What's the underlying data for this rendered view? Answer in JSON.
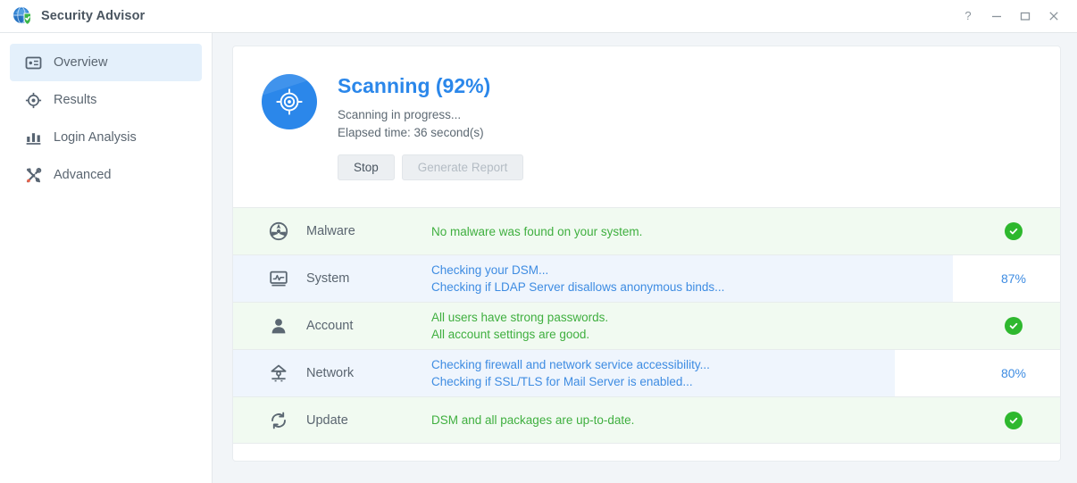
{
  "window": {
    "title": "Security Advisor",
    "app_icon": "shield-globe-icon",
    "controls": [
      {
        "name": "help-button",
        "glyph": "?"
      },
      {
        "name": "minimize-button",
        "glyph": "—"
      },
      {
        "name": "maximize-button",
        "glyph": "□"
      },
      {
        "name": "close-button",
        "glyph": "✕"
      }
    ]
  },
  "sidebar": {
    "items": [
      {
        "label": "Overview",
        "icon": "overview-card-icon",
        "active": true
      },
      {
        "label": "Results",
        "icon": "target-crosshair-icon",
        "active": false
      },
      {
        "label": "Login Analysis",
        "icon": "bar-chart-icon",
        "active": false
      },
      {
        "label": "Advanced",
        "icon": "tools-icon",
        "active": false
      }
    ]
  },
  "scan": {
    "icon": "scan-target-icon",
    "title": "Scanning (92%)",
    "status_line": "Scanning in progress...",
    "elapsed_line": "Elapsed time: 36 second(s)",
    "stop_label": "Stop",
    "report_label": "Generate Report",
    "report_disabled": true
  },
  "colors": {
    "accent_blue": "#2b87ea",
    "text_blue": "#3e8ce2",
    "ok_green": "#3faf3f",
    "check_green": "#2eb82e",
    "row_ok_bg": "#f1faf1",
    "row_progress_bg": "#eff5fd"
  },
  "rows": [
    {
      "label": "Malware",
      "icon": "radiation-icon",
      "state": "ok",
      "messages": [
        "No malware was found on your system."
      ],
      "status_type": "check",
      "percent_label": ""
    },
    {
      "label": "System",
      "icon": "monitor-waveform-icon",
      "state": "progress",
      "messages": [
        "Checking your DSM...",
        "Checking if LDAP Server disallows anonymous binds..."
      ],
      "status_type": "percent",
      "percent_label": "87%",
      "percent_value": 87
    },
    {
      "label": "Account",
      "icon": "person-icon",
      "state": "ok",
      "messages": [
        "All users have strong passwords.",
        "All account settings are good."
      ],
      "status_type": "check",
      "percent_label": ""
    },
    {
      "label": "Network",
      "icon": "router-icon",
      "state": "progress",
      "messages": [
        "Checking firewall and network service accessibility...",
        "Checking if SSL/TLS for Mail Server is enabled..."
      ],
      "status_type": "percent",
      "percent_label": "80%",
      "percent_value": 80
    },
    {
      "label": "Update",
      "icon": "refresh-icon",
      "state": "ok",
      "messages": [
        "DSM and all packages are up-to-date."
      ],
      "status_type": "check",
      "percent_label": ""
    }
  ]
}
